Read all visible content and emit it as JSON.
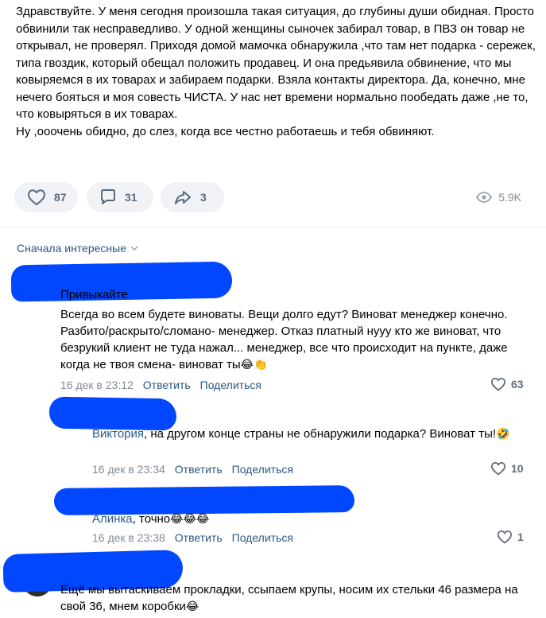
{
  "post": {
    "paragraphs": [
      "Здравствуйте. У меня сегодня произошла такая ситуация, до глубины души обидная. Просто обвинили так несправедливо. У одной женщины сыночек забирал товар, в ПВЗ он товар не открывал, не проверял. Приходя домой мамочка обнаружила ,что там нет подарка - сережек, типа гвоздик, который обещал положить продавец. И она предьявила обвинение, что мы ковыряемся в их товарах и забираем подарки. Взяла контакты директора. Да, конечно, мне нечего бояться и моя совесть ЧИСТА. У нас нет времени нормально пообедать даже ,не то, что ковыряться в их товарах.",
      "Ну ,ооочень обидно, до слез, когда все честно работаешь и тебя обвиняют."
    ],
    "likes": "87",
    "comments": "31",
    "shares": "3",
    "views": "5.9K"
  },
  "sort_label": "Сначала интересные",
  "comments": [
    {
      "author": "Привыкайте",
      "text": "Всегда во всем будете виноваты. Вещи долго едут? Виноват менеджер конечно. Разбито/раскрыто/сломано- менеджер. Отказ платный нууу кто же виноват, что безрукий клиент не туда нажал... менеджер, все что происходит на пункте, даже когда не твоя смена- виноват ты",
      "emoji": "😂👏",
      "date": "16 дек в 23:12",
      "reply": "Ответить",
      "share": "Поделиться",
      "likes": "63"
    },
    {
      "reply_to": "Виктория",
      "text": ", на другом конце страны не обнаружили подарка? Виноват ты!",
      "emoji": "🤣",
      "date": "16 дек в 23:34",
      "reply": "Ответить",
      "share": "Поделиться",
      "likes": "10"
    },
    {
      "reply_to": "Алинка",
      "text": ", точно",
      "emoji": "😂😂😂",
      "date": "16 дек в 23:38",
      "reply": "Ответить",
      "share": "Поделиться",
      "likes": "1"
    },
    {
      "text": "Ещё мы вытаскиваем прокладки, ссыпаем крупы, носим их стельки 46 размера на свой 36, мнем коробки",
      "emoji": "😂"
    }
  ],
  "colors": {
    "link": "#2a5885",
    "muted": "#818c99",
    "pill_bg": "#f0f2f5",
    "redaction": "#0047ff"
  }
}
